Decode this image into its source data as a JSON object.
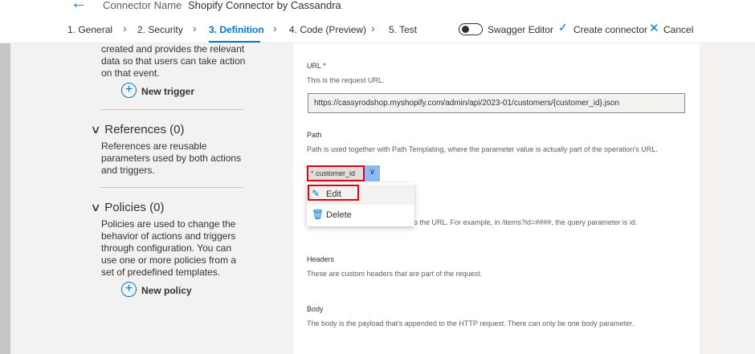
{
  "header": {
    "back_icon": "arrow-left-icon",
    "connector_name_label": "Connector Name",
    "connector_name_value": "Shopify Connector by Cassandra"
  },
  "steps": [
    {
      "label": "1. General",
      "active": false
    },
    {
      "label": "2. Security",
      "active": false
    },
    {
      "label": "3. Definition",
      "active": true
    },
    {
      "label": "4. Code (Preview)",
      "active": false
    },
    {
      "label": "5. Test",
      "active": false
    }
  ],
  "toolbar": {
    "swagger_label": "Swagger Editor",
    "swagger_on": false,
    "create_label": "Create connector",
    "cancel_label": "Cancel"
  },
  "left_panel": {
    "triggers_desc": [
      "created and provides the relevant",
      "data so that users can take action",
      "on that event."
    ],
    "new_trigger_label": "New trigger",
    "references_heading": "References (0)",
    "references_desc": [
      "References are reusable",
      "parameters used by both actions",
      "and triggers."
    ],
    "policies_heading": "Policies (0)",
    "policies_desc": [
      "Policies are used to change the",
      "behavior of actions and triggers",
      "through configuration. You can",
      "use one or more policies from a",
      "set of predefined templates."
    ],
    "new_policy_label": "New policy"
  },
  "main": {
    "url_label": "URL *",
    "url_desc": "This is the request URL.",
    "url_value": "https://cassyrodshop.myshopify.com/admin/api/2023-01/customers/{customer_id}.json",
    "path_label": "Path",
    "path_desc": "Path is used together with Path Templating, where the parameter value is actually part of the operation's URL.",
    "path_param": "customer_id",
    "query_desc_partial": "o the URL. For example, in /items?id=####, the query parameter is id.",
    "headers_label": "Headers",
    "headers_desc": "These are custom headers that are part of the request.",
    "body_label": "Body",
    "body_desc": "The body is the payload that's appended to the HTTP request. There can only be one body parameter."
  },
  "context_menu": {
    "edit_label": "Edit",
    "delete_label": "Delete"
  },
  "colors": {
    "accent": "#0078d4",
    "highlight_red": "#e3000f"
  }
}
